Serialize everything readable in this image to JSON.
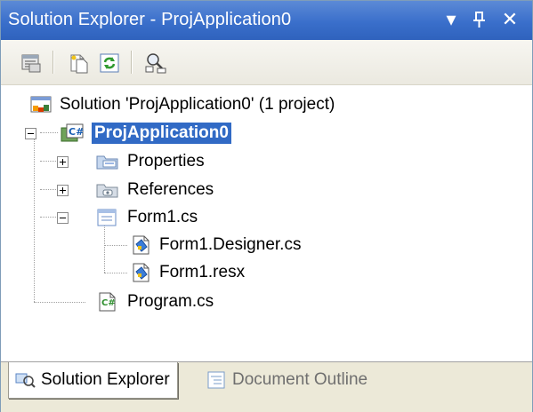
{
  "titlebar": {
    "title": "Solution Explorer - ProjApplication0",
    "dropdown_glyph": "▾",
    "pin_glyph": "⊥",
    "close_glyph": "✕"
  },
  "toolbar": {
    "buttons": [
      {
        "icon": "properties-icon"
      },
      {
        "icon": "show-all-files-icon"
      },
      {
        "icon": "refresh-icon"
      },
      {
        "icon": "class-diagram-icon"
      }
    ]
  },
  "tree": {
    "solution": "Solution 'ProjApplication0' (1 project)",
    "project": "ProjApplication0",
    "properties": "Properties",
    "references": "References",
    "form1": "Form1.cs",
    "form1_designer": "Form1.Designer.cs",
    "form1_resx": "Form1.resx",
    "program": "Program.cs"
  },
  "tabs": {
    "solution_explorer": "Solution Explorer",
    "document_outline": "Document Outline"
  },
  "colors": {
    "title_bar": "#3a6fcb",
    "selection": "#316ac5"
  }
}
